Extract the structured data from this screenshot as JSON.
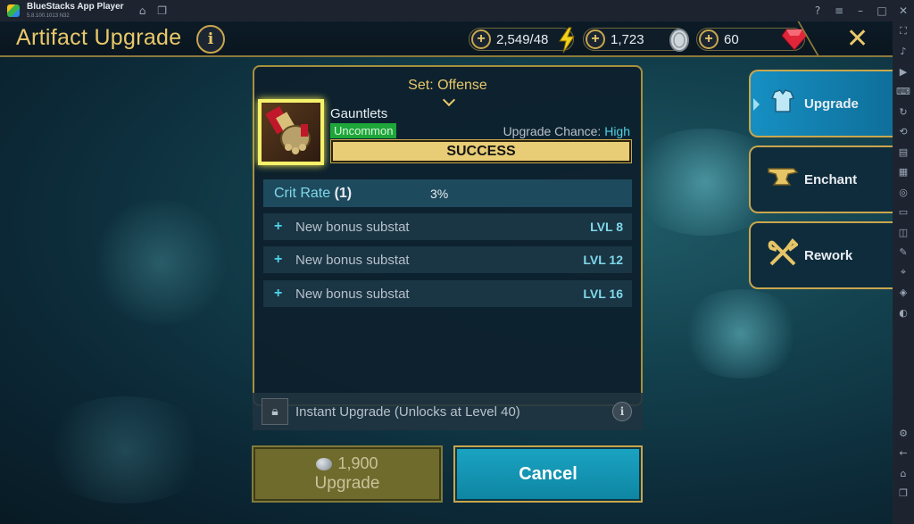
{
  "window": {
    "app_name": "BlueStacks App Player",
    "version": "5.8.100.1013 N32"
  },
  "header": {
    "title": "Artifact Upgrade",
    "info_label": "i",
    "close_label": "✕"
  },
  "resources": [
    {
      "plus": "+",
      "value": "2,549/48",
      "icon": "energy-icon"
    },
    {
      "plus": "+",
      "value": "1,723",
      "icon": "silver-coin-icon"
    },
    {
      "plus": "+",
      "value": "60",
      "icon": "ruby-gem-icon"
    }
  ],
  "artifact": {
    "set_label": "Set: Offense",
    "name": "Gauntlets",
    "rarity": "Uncommon",
    "chance_label": "Upgrade Chance: ",
    "chance_value": "High",
    "result": "SUCCESS",
    "main_stat": {
      "name": "Crit Rate",
      "count": "(1)",
      "value": "3%"
    },
    "substats": [
      {
        "plus": "+",
        "label": "New bonus substat",
        "level": "LVL 8"
      },
      {
        "plus": "+",
        "label": "New bonus substat",
        "level": "LVL 12"
      },
      {
        "plus": "+",
        "label": "New bonus substat",
        "level": "LVL 16"
      }
    ]
  },
  "instant_upgrade": {
    "label": "Instant Upgrade (Unlocks at Level 40)",
    "info_label": "i"
  },
  "buttons": {
    "upgrade_cost": "1,900",
    "upgrade_label": "Upgrade",
    "cancel_label": "Cancel"
  },
  "tabs": [
    {
      "label": "Upgrade",
      "icon": "armor-icon",
      "active": true
    },
    {
      "label": "Enchant",
      "icon": "anvil-icon",
      "active": false
    },
    {
      "label": "Rework",
      "icon": "tools-icon",
      "active": false
    }
  ],
  "colors": {
    "gold": "#e9c86a",
    "rarity_green": "#1ea63a",
    "chance_cyan": "#4fd2e6",
    "cancel_blue": "#1aa3c2"
  }
}
